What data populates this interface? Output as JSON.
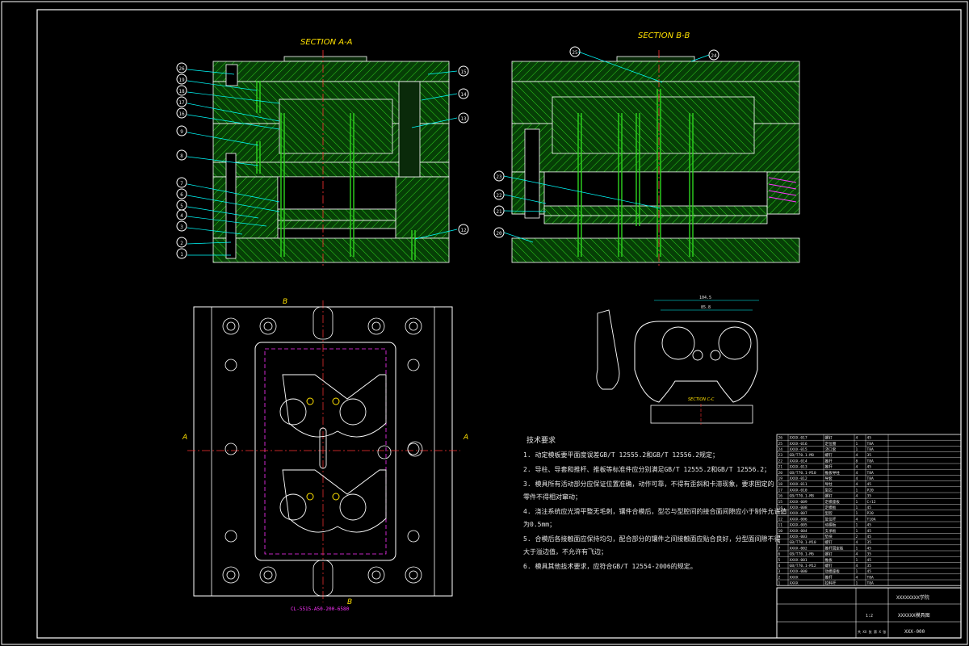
{
  "drawing": {
    "section_a_title": "SECTION A-A",
    "section_b_title": "SECTION B-B",
    "section_c_title": "SECTION C-C",
    "plan_cut_top": "B",
    "plan_cut_bottom": "B",
    "plan_cut_left": "A",
    "plan_cut_right": "A",
    "plan_note": "CL-5515-A50-200-6580",
    "section_a_callouts": [
      "26",
      "19",
      "18",
      "17",
      "16",
      "9",
      "8",
      "7",
      "6",
      "5",
      "4",
      "3",
      "2",
      "1"
    ],
    "section_a_right_callouts": [
      "15",
      "14",
      "13",
      "12"
    ],
    "section_b_callouts": [
      "23",
      "22",
      "21",
      "20",
      "10"
    ],
    "section_b_top_callouts": [
      "25",
      "24"
    ],
    "dim_width": "104.5",
    "dim_inner": "85.8",
    "tech_title": "技术要求",
    "tech_notes": [
      "1. 动定模板要平面度误差GB/T 12555.2和GB/T 12556.2规定；",
      "2. 导柱、导套和推杆、推板等标准件应分别满足GB/T 12555.2和GB/T 12556.2；",
      "3. 模具所有活动部分应保证位置准确，动作可靠，不得有歪斜和卡滞现象，要求固定的",
      "   零件不得相对窜动；",
      "4. 浇注系统应光滑平整无毛刺，镶件合模后，型芯与型腔间的接合面间隙应小于制件允许值",
      "   为0.5mm；",
      "5. 合模后各接触面应保持均匀，配合部分的镶件之间接触面应贴合良好，分型面间隙不得",
      "   大于溢边值，不允许有飞边；",
      "6. 模具其他技术要求，应符合GB/T 12554-2006的规定。"
    ],
    "bom_rows": [
      [
        "26",
        "XXXX-017",
        "螺钉",
        "4",
        "45",
        ""
      ],
      [
        "25",
        "XXXX-016",
        "定位圈",
        "1",
        "T8A",
        ""
      ],
      [
        "24",
        "XXXX-015",
        "浇口套",
        "1",
        "T8A",
        ""
      ],
      [
        "23",
        "GB/T70.1-M8",
        "螺钉",
        "4",
        "35",
        ""
      ],
      [
        "22",
        "XXXX-014",
        "推杆",
        "8",
        "T8A",
        ""
      ],
      [
        "21",
        "XXXX-013",
        "推杆",
        "4",
        "45",
        ""
      ],
      [
        "20",
        "GB/T70.1-M10",
        "推板导柱",
        "4",
        "T8A",
        ""
      ],
      [
        "19",
        "XXXX-012",
        "导套",
        "4",
        "T8A",
        ""
      ],
      [
        "18",
        "XXXX-011",
        "导柱",
        "4",
        "45",
        ""
      ],
      [
        "17",
        "XXXX-010",
        "型芯",
        "1",
        "P20",
        ""
      ],
      [
        "16",
        "GB/T70.1-M8",
        "螺钉",
        "4",
        "35",
        ""
      ],
      [
        "15",
        "XXXX-009",
        "定模座板",
        "1",
        "Cr12",
        ""
      ],
      [
        "14",
        "XXXX-008",
        "定模板",
        "1",
        "45",
        ""
      ],
      [
        "13",
        "XXXX-007",
        "型腔",
        "1",
        "P20",
        ""
      ],
      [
        "12",
        "XXXX-006",
        "复位杆",
        "4",
        "T10A",
        ""
      ],
      [
        "11",
        "XXXX-005",
        "动模板",
        "1",
        "45",
        ""
      ],
      [
        "10",
        "XXXX-004",
        "支承板",
        "1",
        "45",
        ""
      ],
      [
        "9",
        "XXXX-003",
        "垫块",
        "2",
        "45",
        ""
      ],
      [
        "8",
        "GB/T70.1-M10",
        "螺钉",
        "4",
        "35",
        ""
      ],
      [
        "7",
        "XXXX-002",
        "推杆固定板",
        "1",
        "45",
        ""
      ],
      [
        "6",
        "GB/T70.1-M6",
        "螺钉",
        "4",
        "35",
        ""
      ],
      [
        "5",
        "XXXX-001",
        "推板",
        "1",
        "45",
        ""
      ],
      [
        "4",
        "GB/T70.1-M12",
        "螺钉",
        "4",
        "35",
        ""
      ],
      [
        "3",
        "XXXX-000",
        "动模座板",
        "1",
        "45",
        ""
      ],
      [
        "2",
        "XXXX",
        "推杆",
        "4",
        "T8A",
        ""
      ],
      [
        "1",
        "XXXX",
        "拉料杆",
        "1",
        "T8A",
        ""
      ]
    ],
    "title_company": "XXXXXXXX学院",
    "title_name": "XXXXXX模具图",
    "title_code": "XXX-000",
    "title_scale": "1:2",
    "title_sheet": "共 XX 张 第 X 张"
  },
  "colors": {
    "hatch": "#2fd51f",
    "frame": "#ffffff",
    "section_title": "#ffe100",
    "accent": "#ff33ff",
    "cyan": "#00ffff",
    "center": "#ff3333"
  }
}
